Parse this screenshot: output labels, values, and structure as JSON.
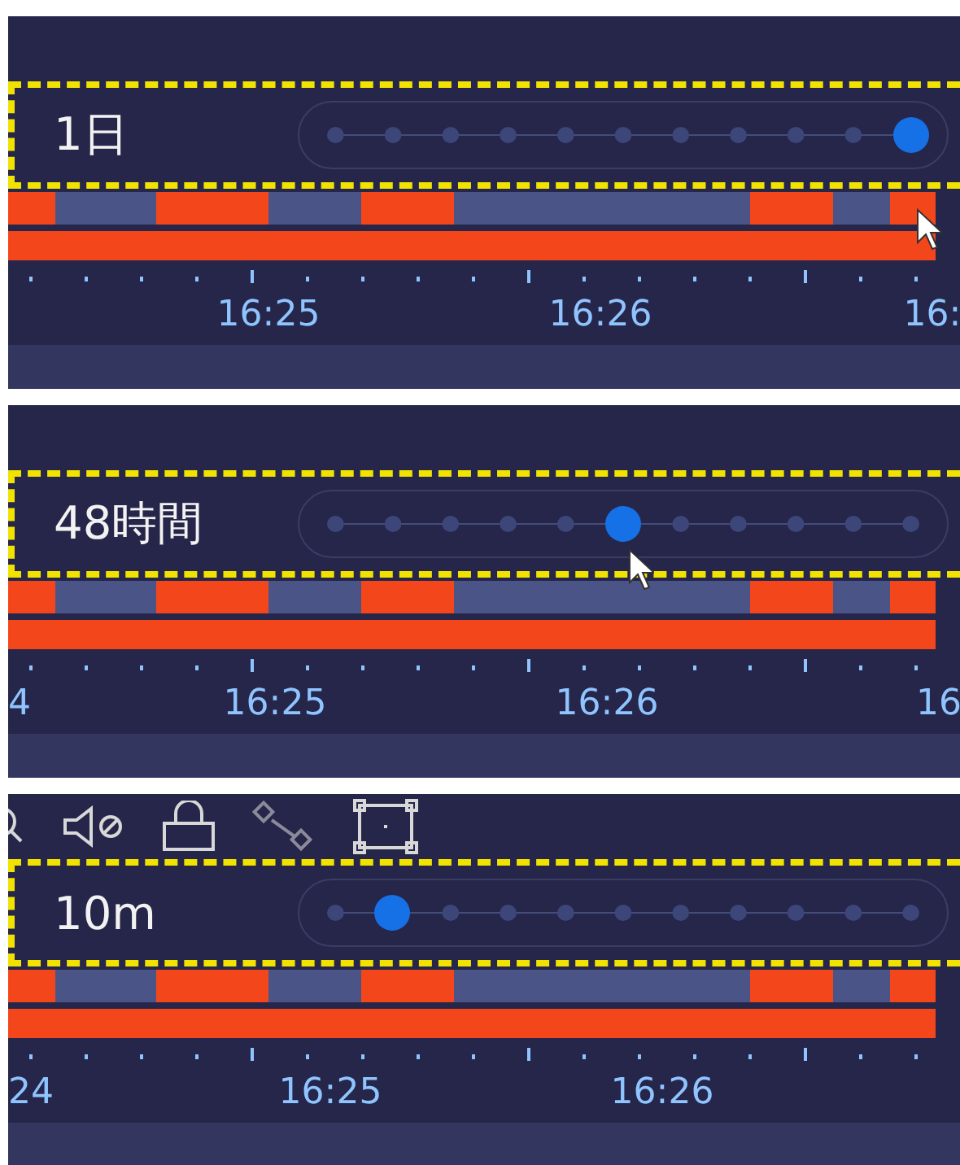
{
  "panels": [
    {
      "kind": "plain",
      "pointer_shown": true,
      "zoom": {
        "label": "1日",
        "level": 1
      },
      "time_labels": [
        {
          "text": "16:25",
          "kind": "slot"
        },
        {
          "text": "16:26",
          "kind": "slot"
        },
        {
          "text": "16:",
          "kind": "slot"
        }
      ]
    },
    {
      "kind": "plain",
      "pointer_shown": true,
      "zoom": {
        "label": "48時間",
        "level": 0.5
      },
      "time_labels": [
        {
          "text": "4",
          "kind": "edge"
        },
        {
          "text": "16:25",
          "kind": "slot"
        },
        {
          "text": "16:26",
          "kind": "slot"
        },
        {
          "text": "16",
          "kind": "slot"
        }
      ]
    },
    {
      "kind": "with_toolbar",
      "pointer_shown": false,
      "zoom": {
        "label": "10m",
        "level": 0.1
      },
      "time_labels": [
        {
          "text": "24",
          "kind": "edge"
        },
        {
          "text": "16:25",
          "kind": "slot"
        },
        {
          "text": "16:26",
          "kind": "slot"
        }
      ]
    }
  ]
}
